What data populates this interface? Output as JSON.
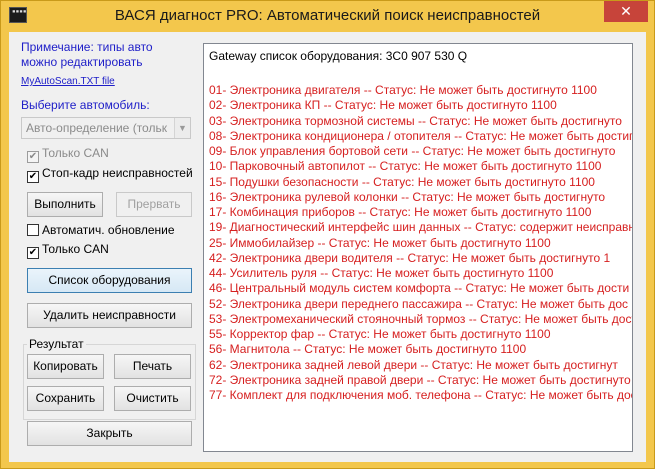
{
  "window": {
    "title": "ВАСЯ диагност PRO:  Автоматический поиск неисправностей",
    "icon_text": "▪▪▪▪",
    "close_label": "✕"
  },
  "left": {
    "note": "Примечание: типы авто можно редактировать",
    "note_link": "MyAutoScan.TXT file",
    "choose_label": "Выберите автомобиль:",
    "car_select_value": "Авто-определение (тольк",
    "only_can_top": {
      "label": "Только CAN",
      "checked": true,
      "disabled": true
    },
    "freeze_frame": {
      "label": "Стоп-кадр неисправностей",
      "checked": true
    },
    "execute_label": "Выполнить",
    "abort_label": "Прервать",
    "auto_update": {
      "label": "Автоматич. обновление",
      "checked": false
    },
    "only_can": {
      "label": "Только CAN",
      "checked": true
    },
    "equipment_list_label": "Список оборудования",
    "clear_faults_label": "Удалить неисправности",
    "result_group_label": "Результат",
    "copy_label": "Копировать",
    "print_label": "Печать",
    "save_label": "Сохранить",
    "clean_label": "Очистить",
    "close_label": "Закрыть"
  },
  "output": {
    "header": "Gateway список оборудования:   3C0 907 530 Q",
    "lines": [
      "01- Электроника двигателя -- Статус: Не может быть достигнуто 1100",
      "02- Электроника КП -- Статус: Не может быть достигнуто 1100",
      "03- Электроника тормозной системы -- Статус: Не может быть достигнуто",
      "08- Электроника кондиционера / отопителя -- Статус: Не может быть достигн",
      "09- Блок управления бортовой сети -- Статус: Не может быть достигнуто",
      "10- Парковочный автопилот -- Статус: Не может быть достигнуто 1100",
      "15- Подушки безопасности -- Статус: Не может быть достигнуто 1100",
      "16- Электроника рулевой колонки -- Статус: Не может быть достигнуто",
      "17- Комбинация приборов -- Статус: Не может быть достигнуто 1100",
      "19- Диагностический интерфейс шин данных -- Статус: содержит неисправн",
      "25- Иммобилайзер -- Статус: Не может быть достигнуто 1100",
      "42- Электроника двери водителя -- Статус: Не может быть достигнуто 1",
      "44- Усилитель руля -- Статус: Не может быть достигнуто 1100",
      "46- Центральный модуль систем комфорта -- Статус: Не может быть дости",
      "52- Электроника двери переднего пассажира -- Статус: Не может быть дос",
      "53- Электромеханический стояночный тормоз -- Статус: Не может быть дост",
      "55- Корректор фар -- Статус: Не может быть достигнуто 1100",
      "56- Магнитола -- Статус: Не может быть достигнуто 1100",
      "62- Электроника задней левой двери -- Статус: Не может быть достигнут",
      "72- Электроника задней правой двери -- Статус: Не может быть достигнуто",
      "77- Комплект для подключения моб. телефона -- Статус: Не может быть дос"
    ]
  },
  "colors": {
    "title_bar": "#f3c74c",
    "close_button": "#c7443a",
    "note_text": "#1e1ec8",
    "status_text": "#d62020"
  }
}
